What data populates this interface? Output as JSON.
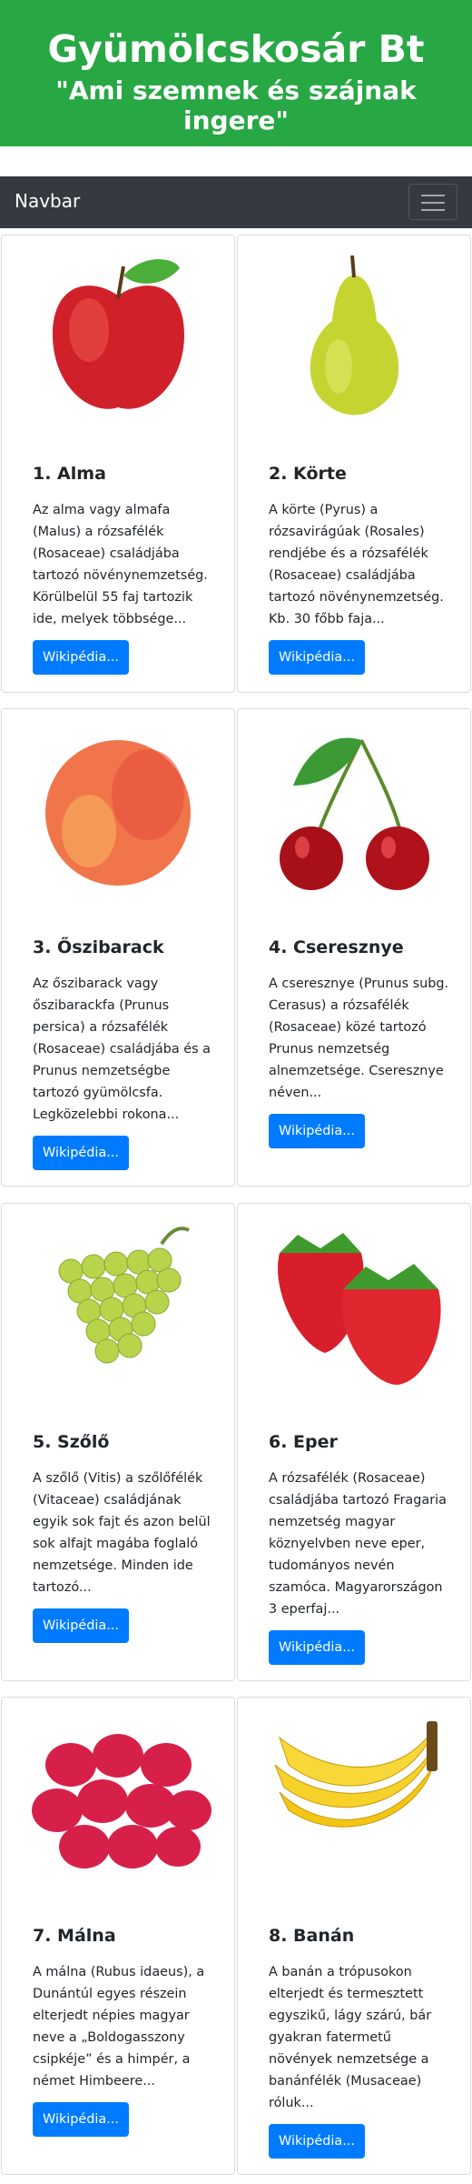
{
  "header": {
    "title": "Gyümölcskosár Bt",
    "subtitle": "\"Ami szemnek és szájnak ingere\""
  },
  "navbar": {
    "brand": "Navbar"
  },
  "colors": {
    "header_bg": "#28a745",
    "navbar_bg": "#343a40",
    "button_bg": "#007bff"
  },
  "cards": [
    {
      "title": "1. Alma",
      "text": "Az alma vagy almafa (Malus) a rózsafélék (Rosaceae) családjába tartozó növénynemzetség. Körülbelül 55 faj tartozik ide, melyek többsége...",
      "button": "Wikipédia..."
    },
    {
      "title": "2. Körte",
      "text": "A körte (Pyrus) a rózsavirágúak (Rosales) rendjébe és a rózsafélék (Rosaceae) családjába tartozó növénynemzetség. Kb. 30 főbb faja...",
      "button": "Wikipédia..."
    },
    {
      "title": "3. Őszibarack",
      "text": "Az őszibarack vagy őszibarackfa (Prunus persica) a rózsafélék (Rosaceae) családjába és a Prunus nemzetségbe tartozó gyümölcsfa. Legközelebbi rokona...",
      "button": "Wikipédia..."
    },
    {
      "title": "4. Cseresznye",
      "text": "A cseresznye (Prunus subg. Cerasus) a rózsafélék (Rosaceae) közé tartozó Prunus nemzetség alnemzetsége. Cseresznye néven...",
      "button": "Wikipédia..."
    },
    {
      "title": "5. Szőlő",
      "text": "A szőlő (Vitis) a szőlőfélék (Vitaceae) családjának egyik sok fajt és azon belül sok alfajt magába foglaló nemzetsége. Minden ide tartozó...",
      "button": "Wikipédia..."
    },
    {
      "title": "6. Eper",
      "text": "A rózsafélék (Rosaceae) családjába tartozó Fragaria nemzetség magyar köznyelvben neve eper, tudományos nevén szamóca. Magyarországon 3 eperfaj...",
      "button": "Wikipédia..."
    },
    {
      "title": "7. Málna",
      "text": "A málna (Rubus idaeus), a Dunántúl egyes részein elterjedt népies magyar neve a „Boldogasszony csipkéje” és a himpér, a német Himbeere...",
      "button": "Wikipédia..."
    },
    {
      "title": "8. Banán",
      "text": "A banán a trópusokon elterjedt és termesztett egyszikű, lágy szárú, bár gyakran fatermetű növények nemzetsége a banánfélék (Musaceae) róluk...",
      "button": "Wikipédia..."
    }
  ]
}
